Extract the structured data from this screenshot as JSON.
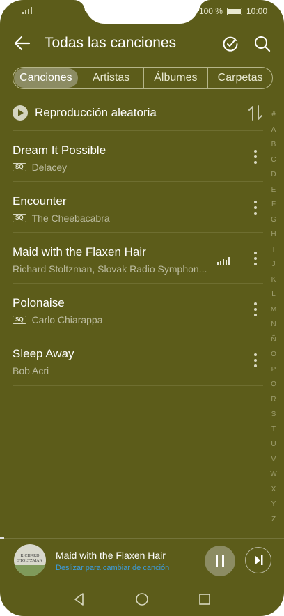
{
  "status_bar": {
    "battery_text": "100 %",
    "time": "10:00"
  },
  "app_bar": {
    "title": "Todas las canciones",
    "back_icon": "arrow-left",
    "action_icons": [
      "refresh-check",
      "search"
    ]
  },
  "tabs": [
    {
      "label": "Canciones",
      "active": true
    },
    {
      "label": "Artistas",
      "active": false
    },
    {
      "label": "Álbumes",
      "active": false
    },
    {
      "label": "Carpetas",
      "active": false
    }
  ],
  "shuffle": {
    "label": "Reproducción aleatoria"
  },
  "songs": [
    {
      "title": "Dream It Possible",
      "artist": "Delacey",
      "sq": true
    },
    {
      "title": "Encounter",
      "artist": "The Cheebacabra",
      "sq": true
    },
    {
      "title": "Maid with the Flaxen Hair",
      "artist": "Richard Stoltzman, Slovak Radio Symphon...",
      "sq": false,
      "playing": true
    },
    {
      "title": "Polonaise",
      "artist": "Carlo Chiarappa",
      "sq": true
    },
    {
      "title": "Sleep Away",
      "artist": "Bob Acri",
      "sq": false
    }
  ],
  "sq_badge": "SQ",
  "index_letters": [
    "#",
    "A",
    "B",
    "C",
    "D",
    "E",
    "F",
    "G",
    "H",
    "I",
    "J",
    "K",
    "L",
    "M",
    "N",
    "Ñ",
    "O",
    "P",
    "Q",
    "R",
    "S",
    "T",
    "U",
    "V",
    "W",
    "X",
    "Y",
    "Z"
  ],
  "mini_player": {
    "title": "Maid with the Flaxen Hair",
    "subtitle": "Deslizar para cambiar de canción",
    "album_art_text": "RICHARD STOLTZMAN"
  },
  "colors": {
    "background": "#5c5c1a",
    "accent_link": "#3b9de0"
  }
}
